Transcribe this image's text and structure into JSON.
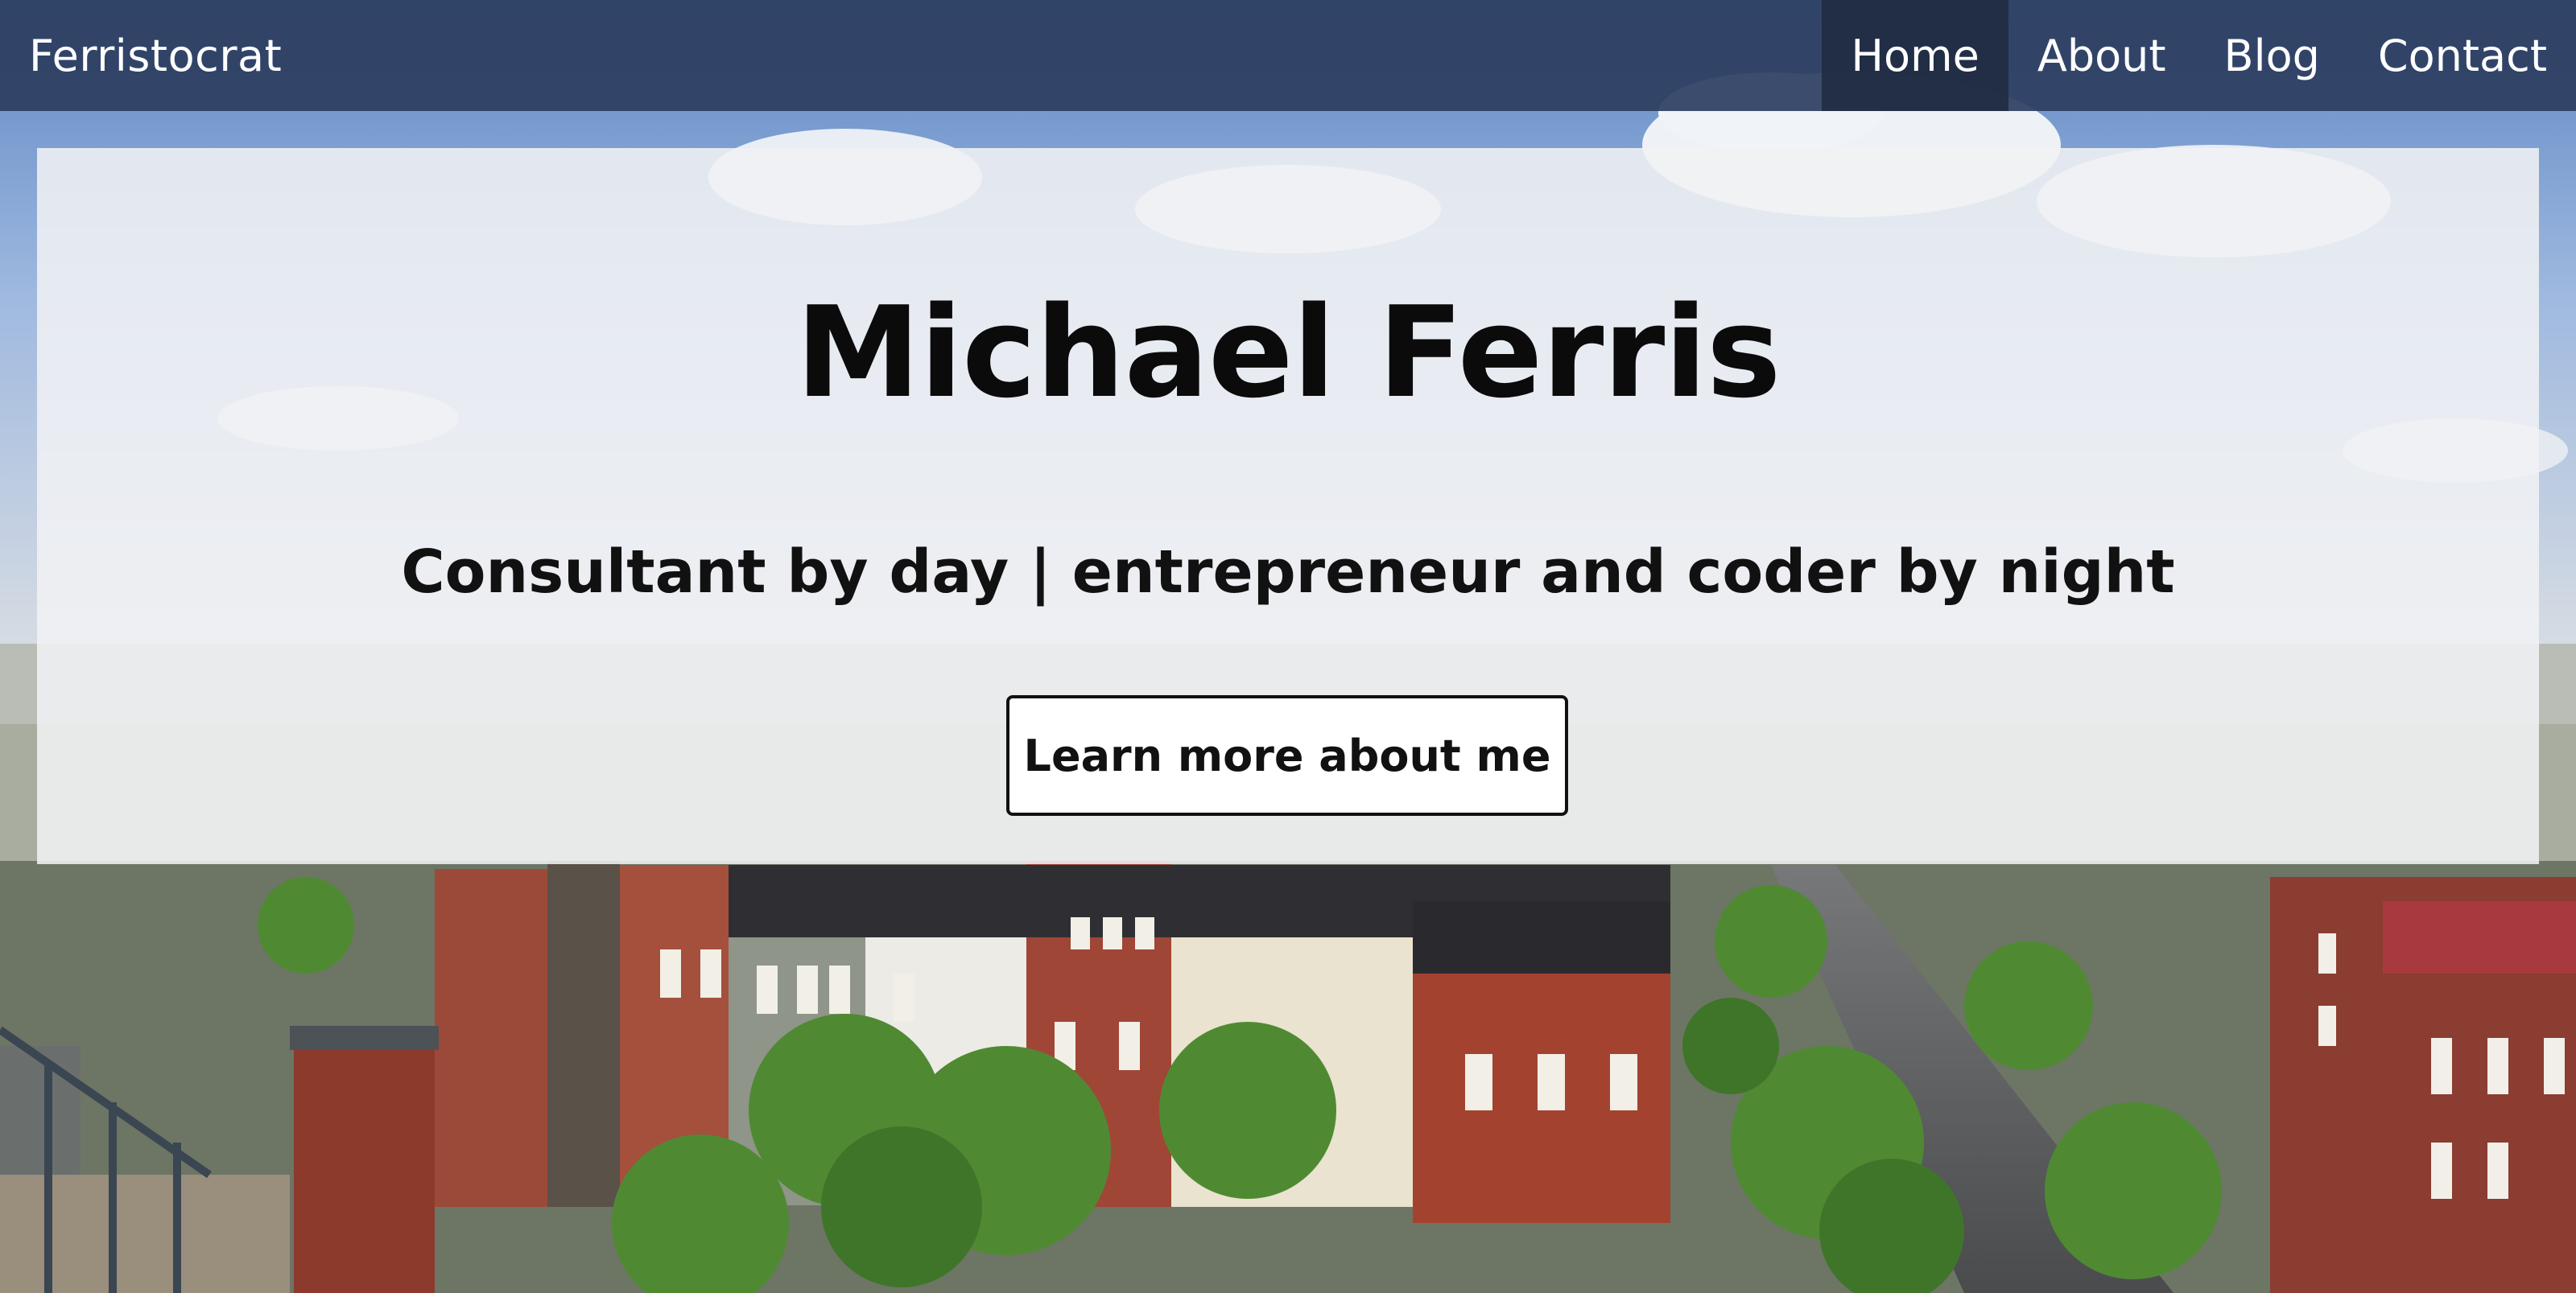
{
  "navbar": {
    "brand": "Ferristocrat",
    "links": [
      {
        "label": "Home",
        "active": true
      },
      {
        "label": "About",
        "active": false
      },
      {
        "label": "Blog",
        "active": false
      },
      {
        "label": "Contact",
        "active": false
      }
    ]
  },
  "hero": {
    "title": "Michael Ferris",
    "subtitle": "Consultant by day | entrepreneur and coder by night",
    "cta_label": "Learn more about me"
  },
  "colors": {
    "navbar": "#2c3e5f",
    "nav_active": "#1e2a40",
    "hero_panel": "#f0f1f4",
    "text": "#0b0b0b"
  }
}
